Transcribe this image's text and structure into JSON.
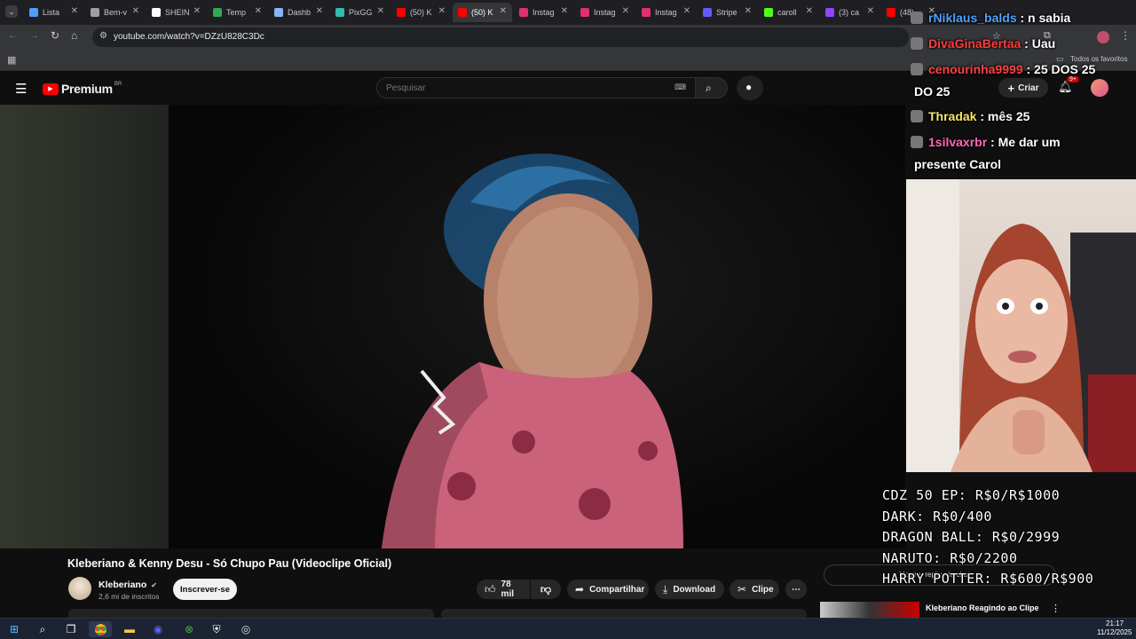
{
  "browser": {
    "tabs": [
      {
        "label": "Lista",
        "color": "#4a9eff"
      },
      {
        "label": "Bem-v",
        "color": "#9aa0a6"
      },
      {
        "label": "SHEIN",
        "color": "#ffffff"
      },
      {
        "label": "Temp",
        "color": "#34a853"
      },
      {
        "label": "Dashb",
        "color": "#8ab4f8"
      },
      {
        "label": "PixGG",
        "color": "#32bcad"
      },
      {
        "label": "(50) K",
        "color": "#ff0000"
      },
      {
        "label": "(50) K",
        "color": "#ff0000"
      },
      {
        "label": "Instag",
        "color": "#e1306c"
      },
      {
        "label": "Instag",
        "color": "#e1306c"
      },
      {
        "label": "Instag",
        "color": "#e1306c"
      },
      {
        "label": "Stripe",
        "color": "#635bff"
      },
      {
        "label": "caroll",
        "color": "#53fc18"
      },
      {
        "label": "(3) ca",
        "color": "#9146ff"
      },
      {
        "label": "(48)",
        "color": "#ff0000"
      }
    ],
    "url": "youtube.com/watch?v=DZzU828C3Dc",
    "bookmarks_folder": "Todos os favoritos"
  },
  "youtube": {
    "logo": "Premium",
    "logo_region": "BR",
    "search_placeholder": "Pesquisar",
    "create_label": "Criar",
    "notif_badge": "9+",
    "video_title": "Kleberiano & Kenny Desu - Só Chupo Pau (Videoclipe Oficial)",
    "channel_name": "Kleberiano",
    "subscribers": "2,6 mi de inscritos",
    "subscribe_label": "Inscrever-se",
    "likes": "78 mil",
    "share_label": "Compartilhar",
    "download_label": "Download",
    "clip_label": "Clipe",
    "chat_replay": "Mostrar replay do chat",
    "related_title": "Kleberiano Reagindo ao Clipe"
  },
  "stream_overlay": {
    "chat": [
      {
        "user": "rNiklaus_balds",
        "msg": " : n sabia",
        "color": "#4fa3ff"
      },
      {
        "user": "DivaGinaBertaa",
        "msg": " : Uau",
        "color": "#ff3b3b"
      },
      {
        "user": "cenourinha9999",
        "msg": " : 25 DOS 25",
        "color": "#ff4040"
      },
      {
        "user": "",
        "msg": "DO 25",
        "color": "#ffffff"
      },
      {
        "user": "Thradak",
        "msg": " : mês 25",
        "color": "#f5e663"
      },
      {
        "user": "1silvaxrbr",
        "msg": " : Me dar um",
        "color": "#ff69b4"
      },
      {
        "user": "",
        "msg": "presente Carol",
        "color": "#ffffff"
      }
    ],
    "goals": [
      "CDZ 50 EP: R$0/R$1000",
      "DARK: R$0/400",
      "DRAGON BALL: R$0/2999",
      "NARUTO: R$0/2200",
      "HARRY POTTER: R$600/R$900"
    ]
  },
  "taskbar": {
    "time": "21:17",
    "date": "11/12/2025"
  }
}
